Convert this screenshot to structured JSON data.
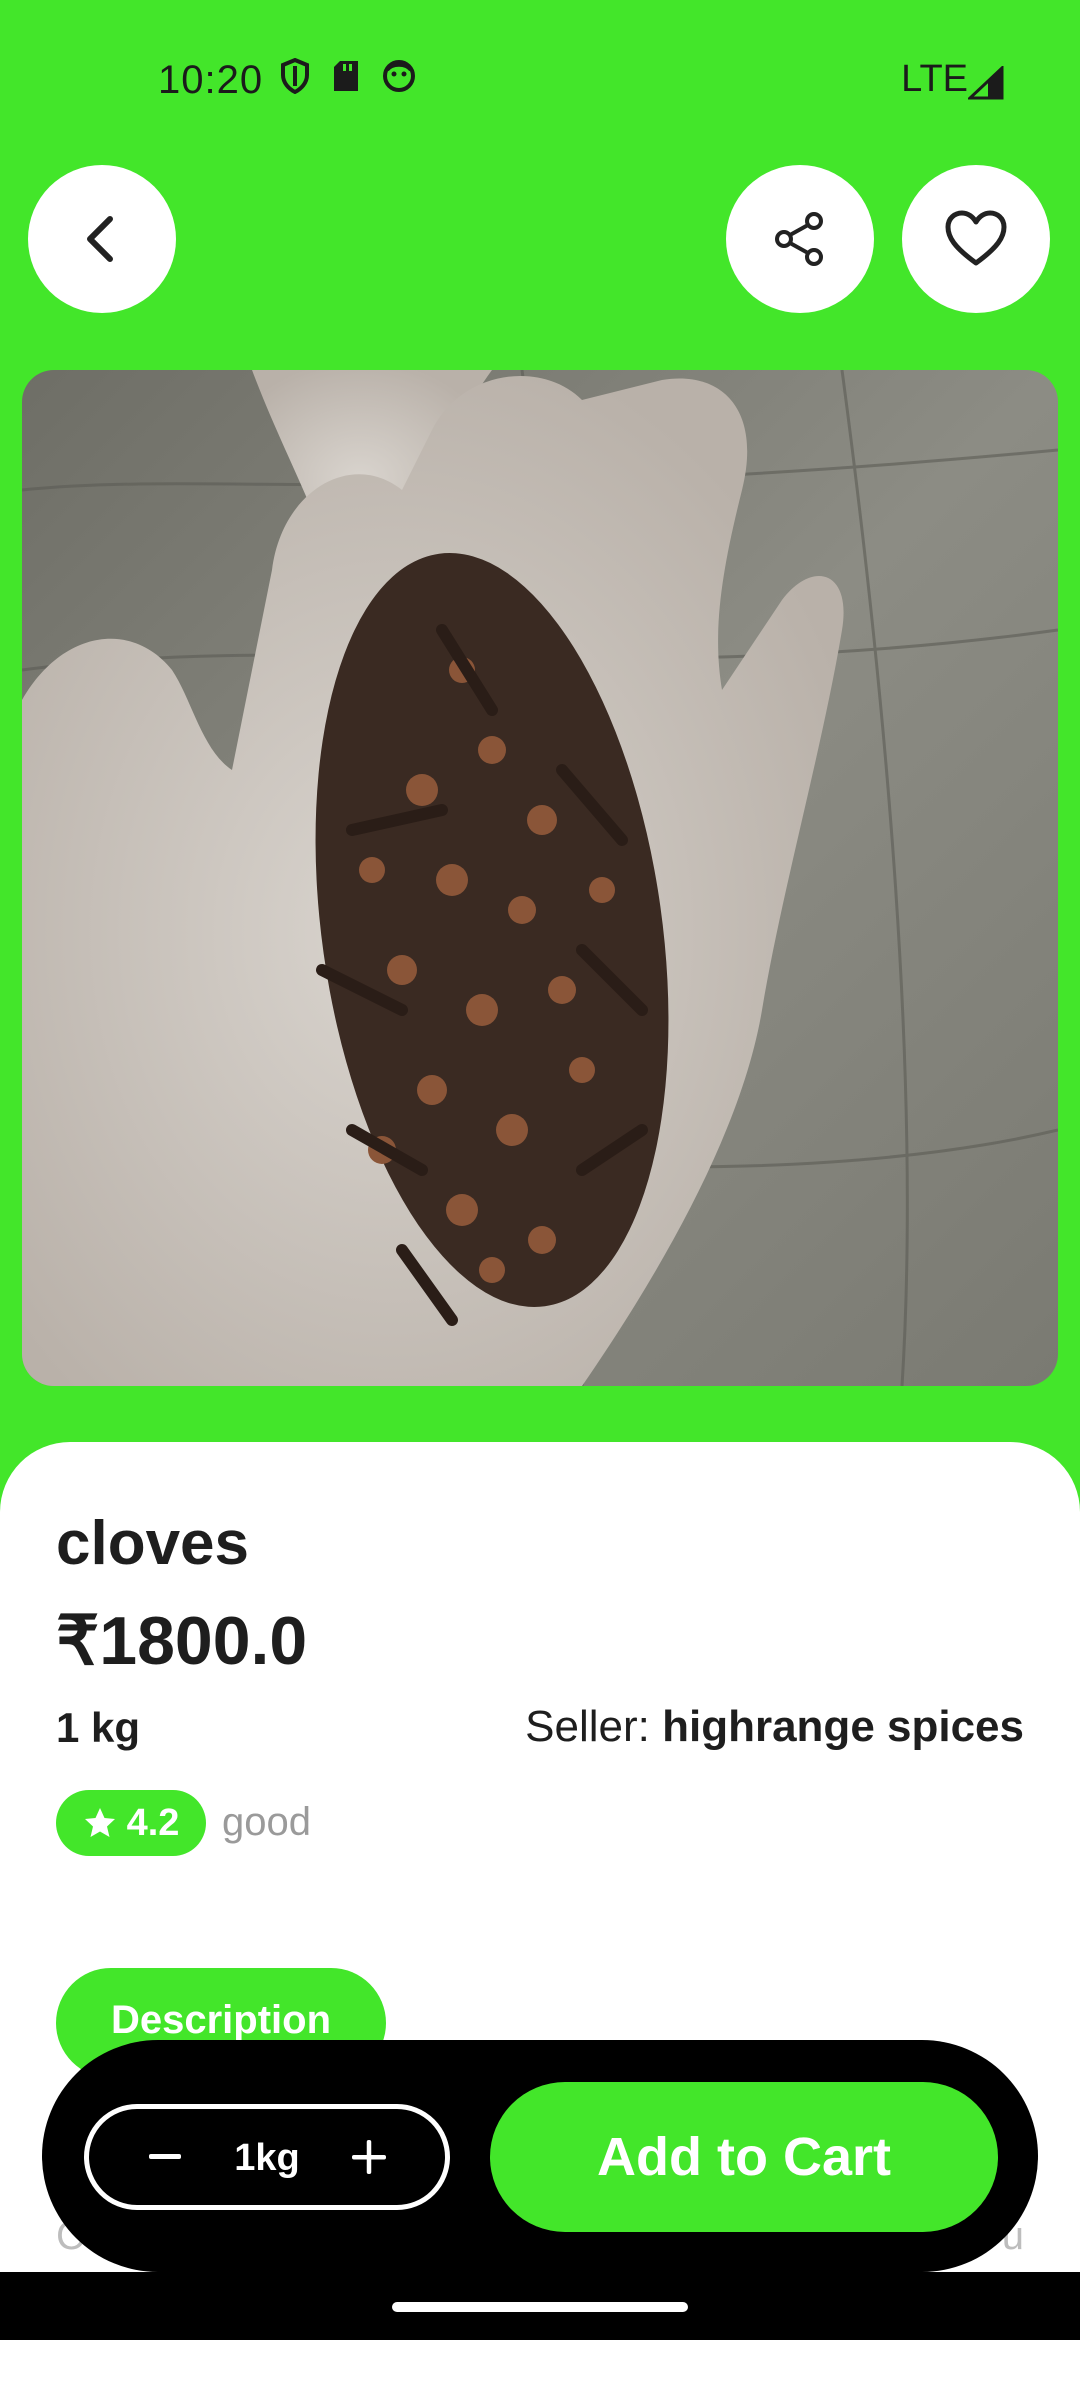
{
  "status": {
    "time": "10:20",
    "network": "LTE"
  },
  "product": {
    "name": "cloves",
    "price": "₹1800.0",
    "quantity": "1 kg",
    "seller_label": "Seller:",
    "seller_name": "highrange spices",
    "rating": "4.2",
    "rating_text": "good"
  },
  "tabs": {
    "description": "Description"
  },
  "peek": {
    "left": "C",
    "right": "u"
  },
  "cart": {
    "qty_value": "1kg",
    "add_label": "Add to Cart"
  },
  "colors": {
    "accent": "#43e62a",
    "bar": "#000000"
  },
  "icons": [
    "back-icon",
    "share-icon",
    "heart-icon",
    "star-icon",
    "minus-icon",
    "plus-icon"
  ]
}
